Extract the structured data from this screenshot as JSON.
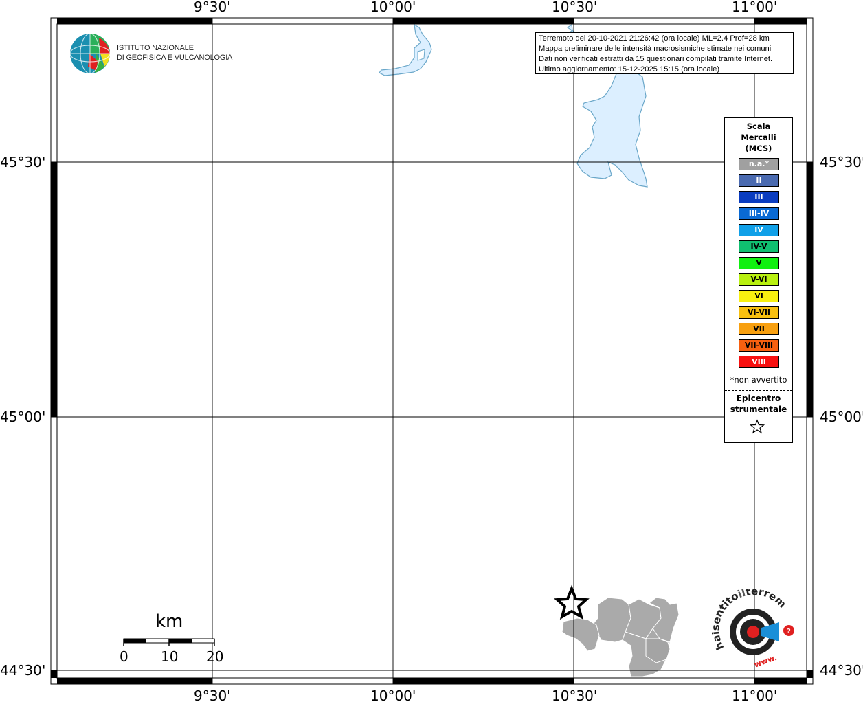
{
  "map": {
    "top_lon_labels": [
      "9°30'",
      "10°00'",
      "10°30'",
      "11°00'"
    ],
    "bottom_lon_labels": [
      "9°30'",
      "10°00'",
      "10°30'",
      "11°00'"
    ],
    "left_lat_labels": [
      "45°30'",
      "45°00'",
      "44°30'"
    ],
    "right_lat_labels": [
      "45°30'",
      "45°00'",
      "44°30'"
    ],
    "land_color": "#aaaaaa",
    "water_color": "#dcefff",
    "water_outline": "#6aa7c9",
    "epicenter_symbol": "star-icon"
  },
  "info_box": {
    "lines": [
      "Terremoto del 20-10-2021 21:26:42 (ora locale) ML=2.4 Prof=28 km",
      "Mappa preliminare delle intensità macrosismiche stimate nei comuni",
      "Dati non verificati estratti da 15 questionari compilati tramite Internet.",
      "Ultimo aggiornamento: 15-12-2025 15:15 (ora locale)"
    ]
  },
  "legend": {
    "title_lines": [
      "Scala",
      "Mercalli",
      "(MCS)"
    ],
    "items": [
      {
        "label": "n.a.*",
        "color": "#a0a0a0",
        "text_color": "#ffffff"
      },
      {
        "label": "II",
        "color": "#4a6ab0",
        "text_color": "#ffffff"
      },
      {
        "label": "III",
        "color": "#0a3cc0",
        "text_color": "#ffffff"
      },
      {
        "label": "III-IV",
        "color": "#0a6ad4",
        "text_color": "#ffffff"
      },
      {
        "label": "IV",
        "color": "#10a0e8",
        "text_color": "#ffffff"
      },
      {
        "label": "IV-V",
        "color": "#10c070",
        "text_color": "#000000"
      },
      {
        "label": "V",
        "color": "#10f010",
        "text_color": "#000000"
      },
      {
        "label": "V-VI",
        "color": "#b8f010",
        "text_color": "#000000"
      },
      {
        "label": "VI",
        "color": "#f8f010",
        "text_color": "#000000"
      },
      {
        "label": "VI-VII",
        "color": "#f8c010",
        "text_color": "#000000"
      },
      {
        "label": "VII",
        "color": "#f8a010",
        "text_color": "#000000"
      },
      {
        "label": "VII-VIII",
        "color": "#f86010",
        "text_color": "#000000"
      },
      {
        "label": "VIII",
        "color": "#f81010",
        "text_color": "#ffffff"
      }
    ],
    "na_note": "*non avvertito",
    "epicenter_lines": [
      "Epicentro",
      "strumentale"
    ]
  },
  "logo": {
    "name": "ingv-globe-logo",
    "text_lines": [
      "ISTITUTO NAZIONALE",
      "DI GEOFISICA E VULCANOLOGIA"
    ]
  },
  "scale": {
    "title": "km",
    "ticks": [
      "0",
      "10",
      "20"
    ]
  },
  "watermark_logo": {
    "name": "haisentito-logo",
    "text": "www.haisentitoilterremoto.it ?"
  }
}
